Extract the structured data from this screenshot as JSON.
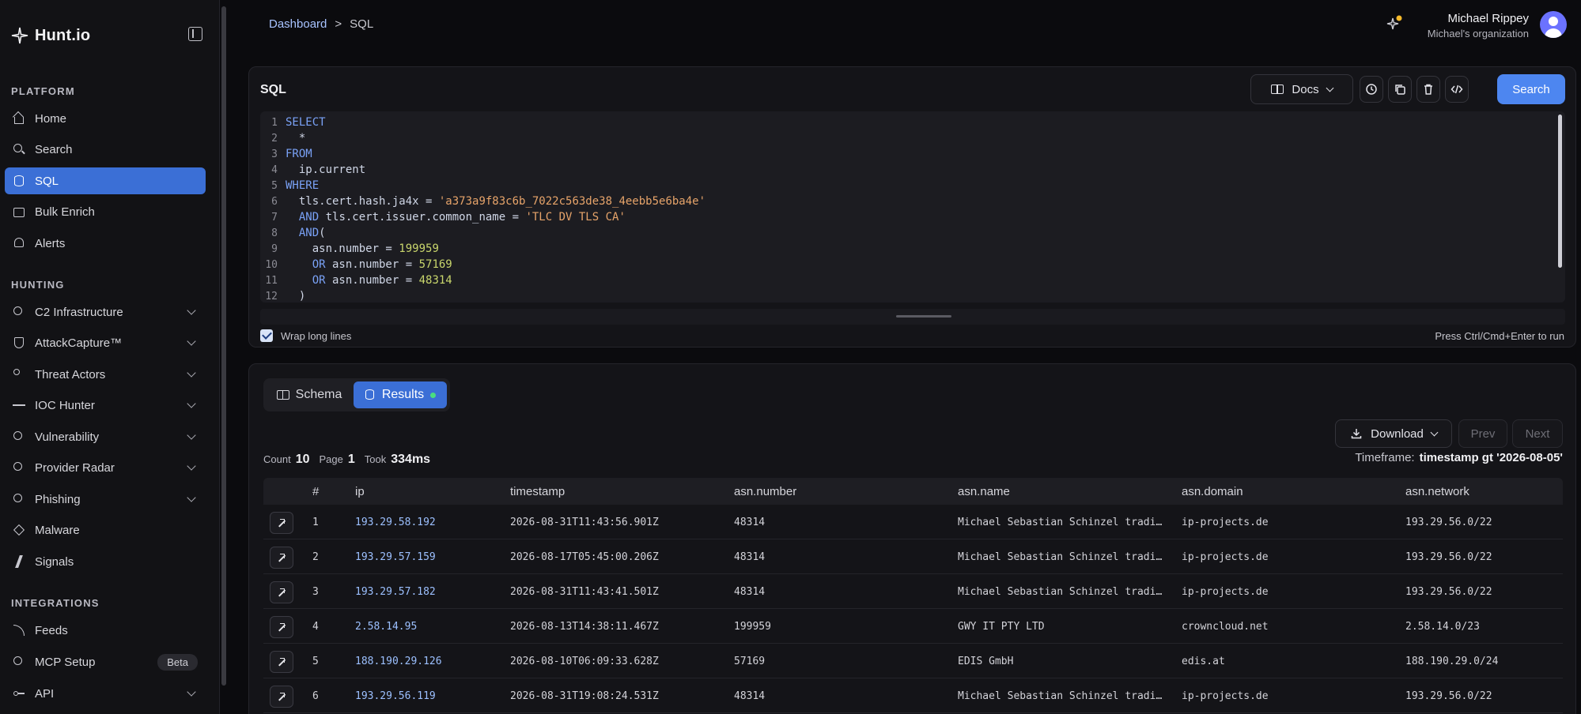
{
  "brand": {
    "name": "Hunt.io"
  },
  "sidebar": {
    "sections": [
      {
        "title": "PLATFORM"
      },
      {
        "title": "HUNTING"
      },
      {
        "title": "INTEGRATIONS"
      }
    ],
    "items": [
      {
        "label": "Home",
        "icon": "home-icon"
      },
      {
        "label": "Search",
        "icon": "search-icon"
      },
      {
        "label": "SQL",
        "icon": "database-icon",
        "active": true
      },
      {
        "label": "Bulk Enrich",
        "icon": "upload-icon"
      },
      {
        "label": "Alerts",
        "icon": "bell-icon"
      },
      {
        "label": "C2 Infrastructure",
        "icon": "radar-icon"
      },
      {
        "label": "AttackCapture™",
        "icon": "shield-icon"
      },
      {
        "label": "Threat Actors",
        "icon": "users-icon"
      },
      {
        "label": "IOC Hunter",
        "icon": "activity-icon"
      },
      {
        "label": "Vulnerability",
        "icon": "bug-icon"
      },
      {
        "label": "Provider Radar",
        "icon": "gauge-icon"
      },
      {
        "label": "Phishing",
        "icon": "globe-icon"
      },
      {
        "label": "Malware",
        "icon": "virus-icon"
      },
      {
        "label": "Signals",
        "icon": "zap-icon"
      },
      {
        "label": "Feeds",
        "icon": "rss-icon"
      },
      {
        "label": "MCP Setup",
        "icon": "plug-icon",
        "badge": "Beta"
      },
      {
        "label": "API",
        "icon": "key-icon"
      }
    ]
  },
  "header": {
    "breadcrumb": [
      "Dashboard",
      ">",
      "SQL"
    ],
    "user_name": "Michael Rippey",
    "org": "Michael's organization"
  },
  "sql_panel": {
    "title": "SQL",
    "docs_label": "Docs",
    "search_label": "Search",
    "wrap_label": "Wrap long lines",
    "hint": "Press Ctrl/Cmd+Enter to run",
    "code_lines": [
      "SELECT",
      "  *",
      "FROM",
      "  ip.current",
      "WHERE",
      "  tls.cert.hash.ja4x = 'a373a9f83c6b_7022c563de38_4eebb5e6ba4e'",
      "  AND tls.cert.issuer.common_name = 'TLC DV TLS CA'",
      "  AND(",
      "    asn.number = 199959",
      "    OR asn.number = 57169",
      "    OR asn.number = 48314",
      "  )"
    ]
  },
  "results": {
    "tabs": {
      "schema": "Schema",
      "results": "Results"
    },
    "download_label": "Download",
    "prev_label": "Prev",
    "next_label": "Next",
    "count_label": "Count",
    "count": "10",
    "page_label": "Page",
    "page": "1",
    "took_label": "Took",
    "took": "334ms",
    "timeframe_label": "Timeframe:",
    "timeframe": "timestamp gt '2026-08-05'",
    "columns": [
      "#",
      "ip",
      "timestamp",
      "asn.number",
      "asn.name",
      "asn.domain",
      "asn.network"
    ],
    "rows": [
      [
        "1",
        "193.29.58.192",
        "2026-08-31T11:43:56.901Z",
        "48314",
        "Michael Sebastian Schinzel tradi…",
        "ip-projects.de",
        "193.29.56.0/22"
      ],
      [
        "2",
        "193.29.57.159",
        "2026-08-17T05:45:00.206Z",
        "48314",
        "Michael Sebastian Schinzel tradi…",
        "ip-projects.de",
        "193.29.56.0/22"
      ],
      [
        "3",
        "193.29.57.182",
        "2026-08-31T11:43:41.501Z",
        "48314",
        "Michael Sebastian Schinzel tradi…",
        "ip-projects.de",
        "193.29.56.0/22"
      ],
      [
        "4",
        "2.58.14.95",
        "2026-08-13T14:38:11.467Z",
        "199959",
        "GWY IT PTY LTD",
        "crowncloud.net",
        "2.58.14.0/23"
      ],
      [
        "5",
        "188.190.29.126",
        "2026-08-10T06:09:33.628Z",
        "57169",
        "EDIS GmbH",
        "edis.at",
        "188.190.29.0/24"
      ],
      [
        "6",
        "193.29.56.119",
        "2026-08-31T19:08:24.531Z",
        "48314",
        "Michael Sebastian Schinzel tradi…",
        "ip-projects.de",
        "193.29.56.0/22"
      ]
    ]
  }
}
